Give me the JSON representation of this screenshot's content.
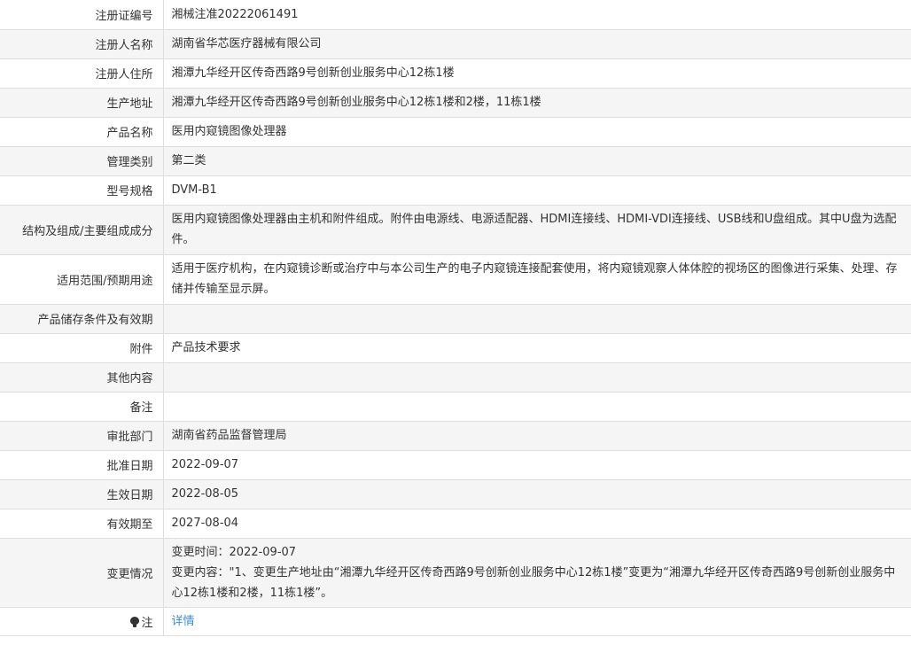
{
  "rows": {
    "reg_no": {
      "label": "注册证编号",
      "value": "湘械注准20222061491"
    },
    "registrant": {
      "label": "注册人名称",
      "value": "湖南省华芯医疗器械有限公司"
    },
    "residence": {
      "label": "注册人住所",
      "value": "湘潭九华经开区传奇西路9号创新创业服务中心12栋1楼"
    },
    "prod_address": {
      "label": "生产地址",
      "value": "湘潭九华经开区传奇西路9号创新创业服务中心12栋1楼和2楼，11栋1楼"
    },
    "product_name": {
      "label": "产品名称",
      "value": "医用内窥镜图像处理器"
    },
    "mgmt_class": {
      "label": "管理类别",
      "value": "第二类"
    },
    "model": {
      "label": "型号规格",
      "value": "DVM-B1"
    },
    "structure": {
      "label": "结构及组成/主要组成成分",
      "value": "医用内窥镜图像处理器由主机和附件组成。附件由电源线、电源适配器、HDMI连接线、HDMI-VDI连接线、USB线和U盘组成。其中U盘为选配件。"
    },
    "scope": {
      "label": "适用范围/预期用途",
      "value": "适用于医疗机构，在内窥镜诊断或治疗中与本公司生产的电子内窥镜连接配套使用，将内窥镜观察人体体腔的视场区的图像进行采集、处理、存储并传输至显示屏。"
    },
    "storage": {
      "label": "产品储存条件及有效期",
      "value": ""
    },
    "attachment": {
      "label": "附件",
      "value": "产品技术要求"
    },
    "other": {
      "label": "其他内容",
      "value": ""
    },
    "remarks": {
      "label": "备注",
      "value": ""
    },
    "approval_dept": {
      "label": "审批部门",
      "value": "湖南省药品监督管理局"
    },
    "approval_date": {
      "label": "批准日期",
      "value": "2022-09-07"
    },
    "effective_date": {
      "label": "生效日期",
      "value": "2022-08-05"
    },
    "expiry_date": {
      "label": "有效期至",
      "value": "2027-08-04"
    },
    "changes": {
      "label": "变更情况",
      "time_line": "变更时间：2022-09-07",
      "content_line": "变更内容：\"1、变更生产地址由“湘潭九华经开区传奇西路9号创新创业服务中心12栋1楼”变更为“湘潭九华经开区传奇西路9号创新创业服务中心12栋1楼和2楼，11栋1楼”。"
    },
    "note": {
      "label": "注",
      "icon": "bulb-icon",
      "link_text": "详情"
    }
  }
}
